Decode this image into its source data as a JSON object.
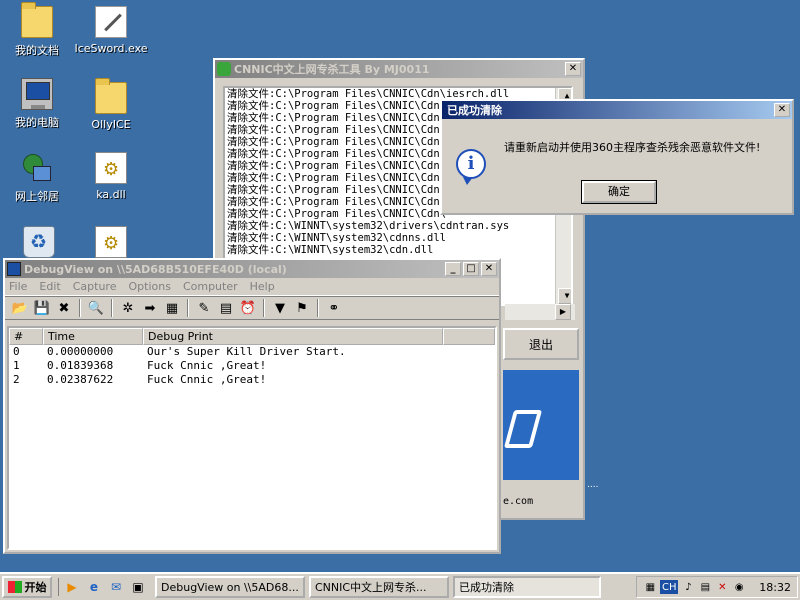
{
  "desktop_icons": [
    {
      "label": "我的文档",
      "icon": "documents-folder-icon"
    },
    {
      "label": "IceSword.exe",
      "icon": "sword-icon"
    },
    {
      "label": "我的电脑",
      "icon": "computer-icon"
    },
    {
      "label": "OllyICE",
      "icon": "folder-icon"
    },
    {
      "label": "网上邻居",
      "icon": "network-icon"
    },
    {
      "label": "ka.dll",
      "icon": "dll-file-icon"
    },
    {
      "label": "",
      "icon": "recycle-bin-icon"
    },
    {
      "label": "",
      "icon": "dll-file-icon"
    }
  ],
  "cnnic_window": {
    "title": "CNNIC中文上网专杀工具 By MJ0011",
    "log_lines": [
      "清除文件:C:\\Program Files\\CNNIC\\Cdn\\iesrch.dll",
      "清除文件:C:\\Program Files\\CNNIC\\Cdn\\",
      "清除文件:C:\\Program Files\\CNNIC\\Cdn\\",
      "清除文件:C:\\Program Files\\CNNIC\\Cdn\\",
      "清除文件:C:\\Program Files\\CNNIC\\Cdn\\",
      "清除文件:C:\\Program Files\\CNNIC\\Cdn\\",
      "清除文件:C:\\Program Files\\CNNIC\\Cdn\\",
      "清除文件:C:\\Program Files\\CNNIC\\Cdn\\",
      "清除文件:C:\\Program Files\\CNNIC\\Cdn\\",
      "清除文件:C:\\Program Files\\CNNIC\\Cdn\\",
      "清除文件:C:\\Program Files\\CNNIC\\Cdn\\",
      "清除文件:C:\\WINNT\\system32\\drivers\\cdntran.sys",
      "清除文件:C:\\WINNT\\system32\\cdnns.dll",
      "清除文件:C:\\WINNT\\system32\\cdn.dll"
    ],
    "exit_label": "退出",
    "email_fragment": "e.com",
    "dots": "...."
  },
  "message_box": {
    "title": "已成功清除",
    "text": "请重新启动并使用360主程序查杀残余恶意软件文件!",
    "ok_label": "确定"
  },
  "debugview": {
    "title": "DebugView on \\\\5AD68B510EFE40D (local)",
    "menu": [
      "File",
      "Edit",
      "Capture",
      "Options",
      "Computer",
      "Help"
    ],
    "columns": [
      "#",
      "Time",
      "Debug Print"
    ],
    "rows": [
      {
        "num": "0",
        "time": "0.00000000",
        "text": "Our's Super Kill Driver Start."
      },
      {
        "num": "1",
        "time": "0.01839368",
        "text": "Fuck Cnnic ,Great!"
      },
      {
        "num": "2",
        "time": "0.02387622",
        "text": "Fuck Cnnic ,Great!"
      }
    ]
  },
  "taskbar": {
    "start_label": "开始",
    "tasks": [
      {
        "label": "DebugView on \\\\5AD68..."
      },
      {
        "label": "CNNIC中文上网专杀..."
      },
      {
        "label": "已成功清除"
      }
    ],
    "clock": "18:32",
    "ime": "CH"
  }
}
